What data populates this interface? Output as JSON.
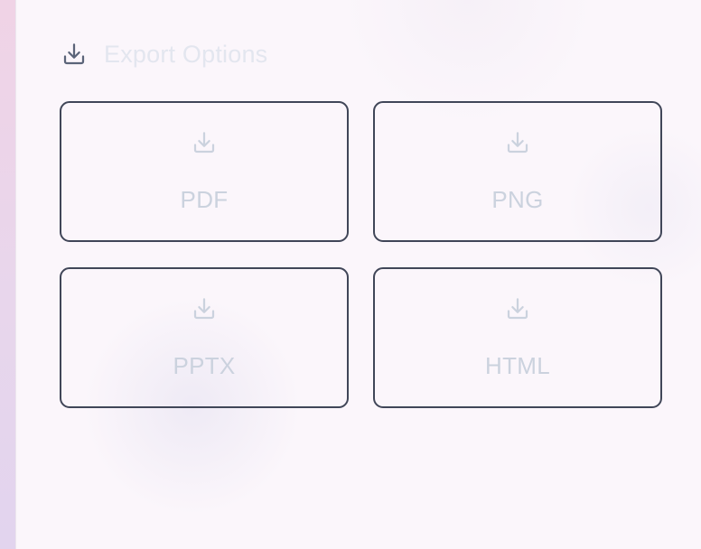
{
  "export": {
    "title": "Export Options",
    "header_icon": "download-icon",
    "formats": [
      {
        "label": "PDF",
        "icon": "download-icon"
      },
      {
        "label": "PNG",
        "icon": "download-icon"
      },
      {
        "label": "PPTX",
        "icon": "download-icon"
      },
      {
        "label": "HTML",
        "icon": "download-icon"
      }
    ]
  },
  "colors": {
    "card_border": "#404658",
    "label_text": "#cbd2de",
    "title_text": "#e3e6ef",
    "header_icon": "#5b6479",
    "card_icon": "#cbd2de",
    "background": "#fbf6fb",
    "side_strip": "#ecd4ea"
  }
}
